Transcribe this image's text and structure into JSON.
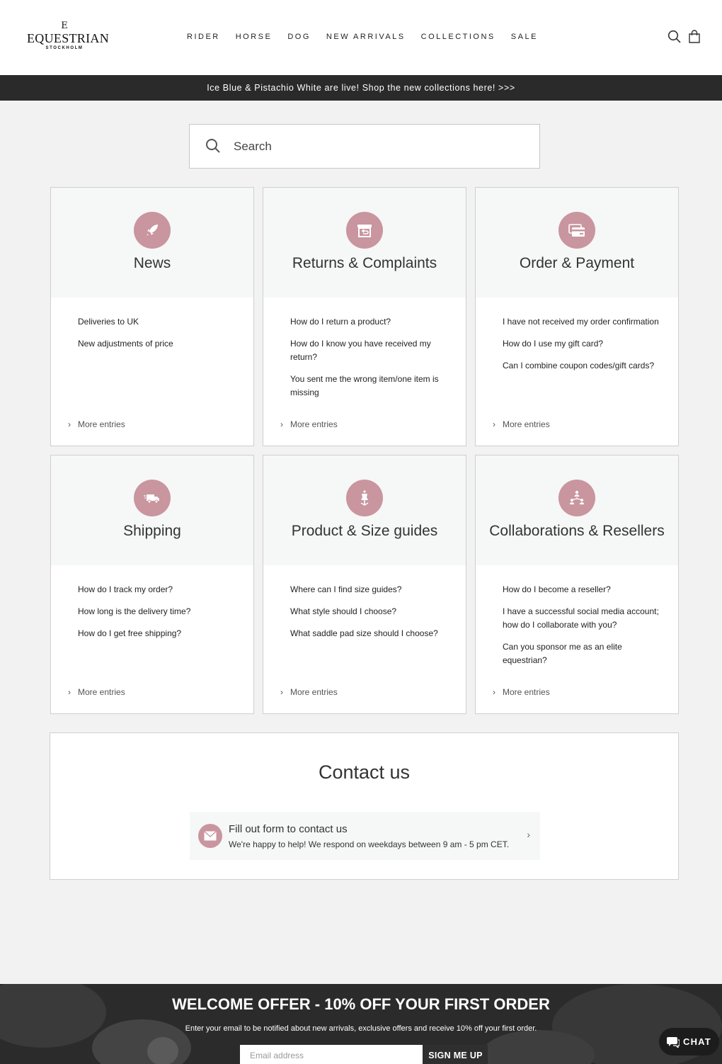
{
  "header": {
    "logo": {
      "mark": "E",
      "main": "EQUESTRIAN",
      "sub": "STOCKHOLM"
    },
    "nav": [
      "RIDER",
      "HORSE",
      "DOG",
      "NEW ARRIVALS",
      "COLLECTIONS",
      "SALE"
    ],
    "icons": [
      "search-icon",
      "cart-icon"
    ]
  },
  "promo": {
    "text": "Ice Blue & Pistachio White are live! Shop the new collections here! >>>"
  },
  "search": {
    "placeholder": "Search"
  },
  "colors": {
    "accent": "#c9959f",
    "dark": "#2a2a2a",
    "card_top": "#f6f7f7"
  },
  "categories": [
    {
      "title": "News",
      "icon": "rocket-icon",
      "entries": [
        "Deliveries to UK",
        "New adjustments of price"
      ],
      "more": "More entries"
    },
    {
      "title": "Returns & Complaints",
      "icon": "return-box-icon",
      "entries": [
        "How do I return a product?",
        "How do I know you have received my return?",
        "You sent me the wrong item/one item is missing"
      ],
      "more": "More entries"
    },
    {
      "title": "Order & Payment",
      "icon": "credit-card-icon",
      "entries": [
        "I have not received my order confirmation",
        "How do I use my gift card?",
        "Can I combine coupon codes/gift cards?"
      ],
      "more": "More entries"
    },
    {
      "title": "Shipping",
      "icon": "truck-icon",
      "entries": [
        "How do I track my order?",
        "How long is the delivery time?",
        "How do I get free shipping?"
      ],
      "more": "More entries"
    },
    {
      "title": "Product & Size guides",
      "icon": "mannequin-icon",
      "entries": [
        "Where can I find size guides?",
        "What style should I choose?",
        "What saddle pad size should I choose?"
      ],
      "more": "More entries"
    },
    {
      "title": "Collaborations & Resellers",
      "icon": "network-icon",
      "entries": [
        "How do I become a reseller?",
        "I have a successful social media account; how do I collaborate with you?",
        "Can you sponsor me as an elite equestrian?"
      ],
      "more": "More entries"
    }
  ],
  "contact": {
    "title": "Contact us",
    "form_title": "Fill out form to contact us",
    "form_sub": "We're happy to help! We respond on weekdays between 9 am - 5 pm CET."
  },
  "footer": {
    "headline": "WELCOME OFFER - 10% OFF YOUR FIRST ORDER",
    "sub": "Enter your email to be notified about new arrivals, exclusive offers and receive 10% off your first order.",
    "email_placeholder": "Email address",
    "button": "SIGN ME UP"
  },
  "chat": {
    "label": "CHAT"
  }
}
